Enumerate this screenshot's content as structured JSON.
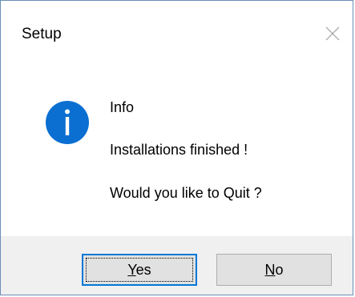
{
  "window": {
    "title": "Setup",
    "close_icon": "close-icon"
  },
  "message": {
    "icon": "info-icon",
    "heading": "Info",
    "line1": "Installations finished !",
    "line2": "Would you like to Quit ?"
  },
  "buttons": {
    "yes": {
      "mnemonic": "Y",
      "rest": "es"
    },
    "no": {
      "mnemonic": "N",
      "rest": "o"
    }
  },
  "colors": {
    "accent": "#0078d7",
    "footer_bg": "#f0f0f0",
    "button_bg": "#e1e1e1"
  }
}
